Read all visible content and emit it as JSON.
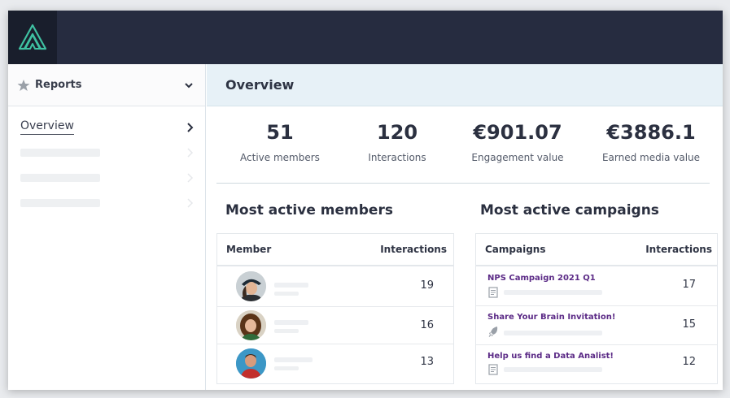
{
  "colors": {
    "topbar": "#262c40",
    "logo_bg": "#191e2c",
    "logo_accent": "#3fc1a2",
    "campaign_link": "#5b2a86"
  },
  "sidebar": {
    "header": {
      "label": "Reports",
      "icon": "star-icon"
    },
    "items": [
      {
        "label": "Overview",
        "active": true
      }
    ]
  },
  "main": {
    "title": "Overview",
    "stats": [
      {
        "value": "51",
        "label": "Active members"
      },
      {
        "value": "120",
        "label": "Interactions"
      },
      {
        "value": "€901.07",
        "label": "Engagement value"
      },
      {
        "value": "€3886.1",
        "label": "Earned media value"
      }
    ],
    "members": {
      "title": "Most active members",
      "columns": [
        "Member",
        "Interactions"
      ],
      "rows": [
        {
          "interactions": "19"
        },
        {
          "interactions": "16"
        },
        {
          "interactions": "13"
        }
      ]
    },
    "campaigns": {
      "title": "Most active campaigns",
      "columns": [
        "Campaigns",
        "Interactions"
      ],
      "rows": [
        {
          "name": "NPS Campaign 2021 Q1",
          "icon": "form-icon",
          "interactions": "17"
        },
        {
          "name": "Share Your Brain Invitation!",
          "icon": "rocket-icon",
          "interactions": "15"
        },
        {
          "name": "Help us find a Data Analist!",
          "icon": "form-icon",
          "interactions": "12"
        }
      ]
    }
  }
}
